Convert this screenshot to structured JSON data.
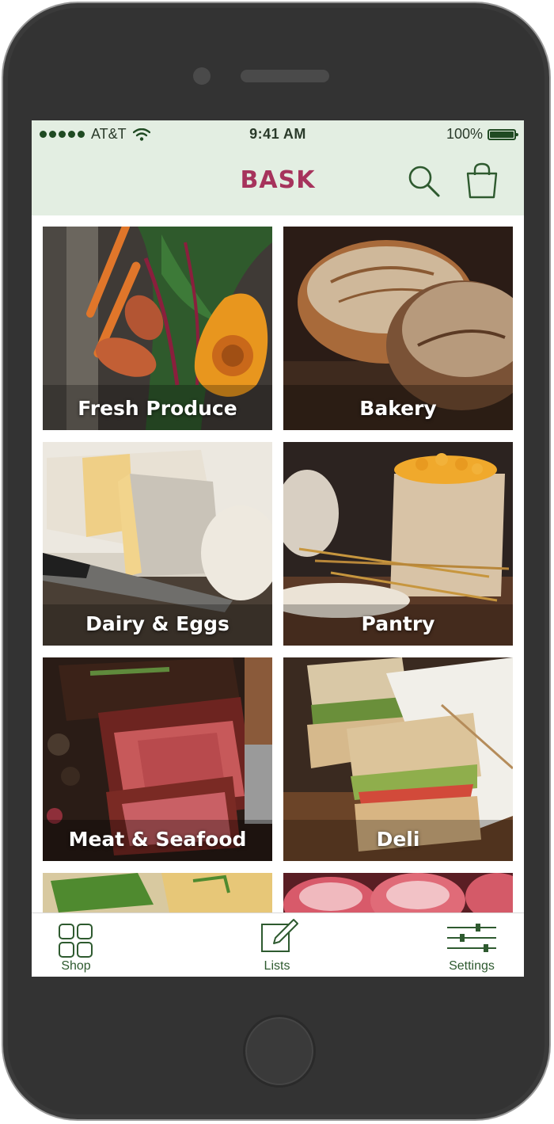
{
  "status_bar": {
    "carrier": "AT&T",
    "time": "9:41 AM",
    "battery": "100%"
  },
  "header": {
    "app_name": "BASK"
  },
  "categories": [
    {
      "label": "Fresh Produce"
    },
    {
      "label": "Bakery"
    },
    {
      "label": "Dairy & Eggs"
    },
    {
      "label": "Pantry"
    },
    {
      "label": "Meat & Seafood"
    },
    {
      "label": "Deli"
    }
  ],
  "tab_bar": {
    "shop": "Shop",
    "lists": "Lists",
    "settings": "Settings"
  },
  "colors": {
    "brand": "#a6335c",
    "accent_green": "#2e5a2f",
    "header_bg": "#e3eee2"
  },
  "icons": [
    "wifi-icon",
    "battery-icon",
    "search-icon",
    "shopping-bag-icon",
    "grid-icon",
    "edit-icon",
    "sliders-icon"
  ]
}
